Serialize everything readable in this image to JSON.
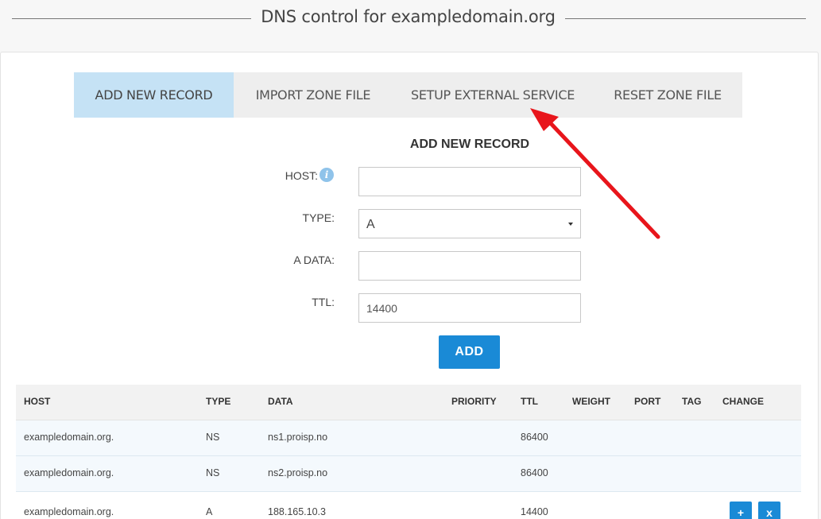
{
  "page": {
    "title": "DNS control for exampledomain.org"
  },
  "tabs": [
    {
      "label": "ADD NEW RECORD",
      "active": true
    },
    {
      "label": "IMPORT ZONE FILE",
      "active": false
    },
    {
      "label": "SETUP EXTERNAL SERVICE",
      "active": false
    },
    {
      "label": "RESET ZONE FILE",
      "active": false
    }
  ],
  "form": {
    "title": "ADD NEW RECORD",
    "host_label": "HOST:",
    "host_value": "",
    "info_icon": "i",
    "type_label": "TYPE:",
    "type_value": "A",
    "adata_label": "A DATA:",
    "adata_value": "",
    "ttl_label": "TTL:",
    "ttl_value": "14400",
    "add_label": "ADD"
  },
  "table": {
    "headers": [
      "HOST",
      "TYPE",
      "DATA",
      "PRIORITY",
      "TTL",
      "WEIGHT",
      "PORT",
      "TAG",
      "CHANGE"
    ],
    "rows": [
      {
        "host": "exampledomain.org.",
        "type": "NS",
        "data": "ns1.proisp.no",
        "priority": "",
        "ttl": "86400"
      },
      {
        "host": "exampledomain.org.",
        "type": "NS",
        "data": "ns2.proisp.no",
        "priority": "",
        "ttl": "86400"
      },
      {
        "host": "exampledomain.org.",
        "type": "A",
        "data": "188.165.10.3",
        "priority": "",
        "ttl": "14400",
        "edit_label": "+",
        "delete_label": "x"
      }
    ]
  },
  "colors": {
    "accent": "#1a8ad6",
    "active_tab": "#c5e2f5",
    "annotation_arrow": "#e8151b"
  }
}
